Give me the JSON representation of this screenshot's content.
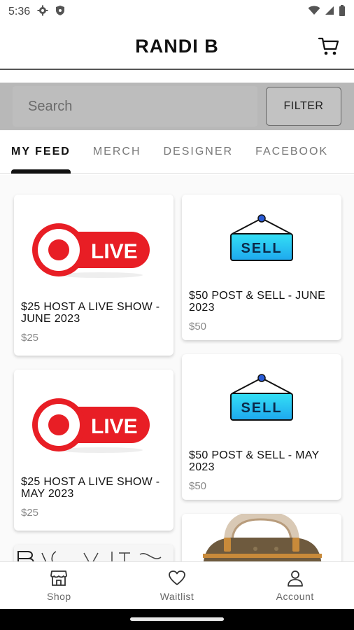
{
  "status_bar": {
    "time": "5:36"
  },
  "header": {
    "title": "RANDI B"
  },
  "search": {
    "placeholder": "Search",
    "filter_label": "FILTER"
  },
  "tabs": [
    {
      "label": "MY FEED",
      "active": true
    },
    {
      "label": "MERCH",
      "active": false
    },
    {
      "label": "DESIGNER",
      "active": false
    },
    {
      "label": "FACEBOOK",
      "active": false
    }
  ],
  "feed": {
    "cards": [
      {
        "title": "$25 HOST A LIVE SHOW  - JUNE 2023",
        "price": "$25",
        "image": "live-badge",
        "live_text": "LIVE"
      },
      {
        "title": "$50  POST & SELL - JUNE 2023",
        "price": "$50",
        "image": "sell-sign",
        "sell_text": "SELL"
      },
      {
        "title": "$25  HOST A LIVE SHOW  -  MAY 2023",
        "price": "$25",
        "image": "live-badge",
        "live_text": "LIVE"
      },
      {
        "title": "$50  POST & SELL - MAY 2023",
        "price": "$50",
        "image": "sell-sign",
        "sell_text": "SELL"
      },
      {
        "title": "",
        "price": "",
        "image": "designer-print"
      },
      {
        "title": "",
        "price": "",
        "image": "handbag-photo"
      }
    ]
  },
  "bottom_nav": {
    "shop": "Shop",
    "waitlist": "Waitlist",
    "account": "Account"
  },
  "colors": {
    "live_red": "#e81e25",
    "sell_cyan": "#2ec4f0",
    "pin_blue": "#2a5bd7"
  }
}
